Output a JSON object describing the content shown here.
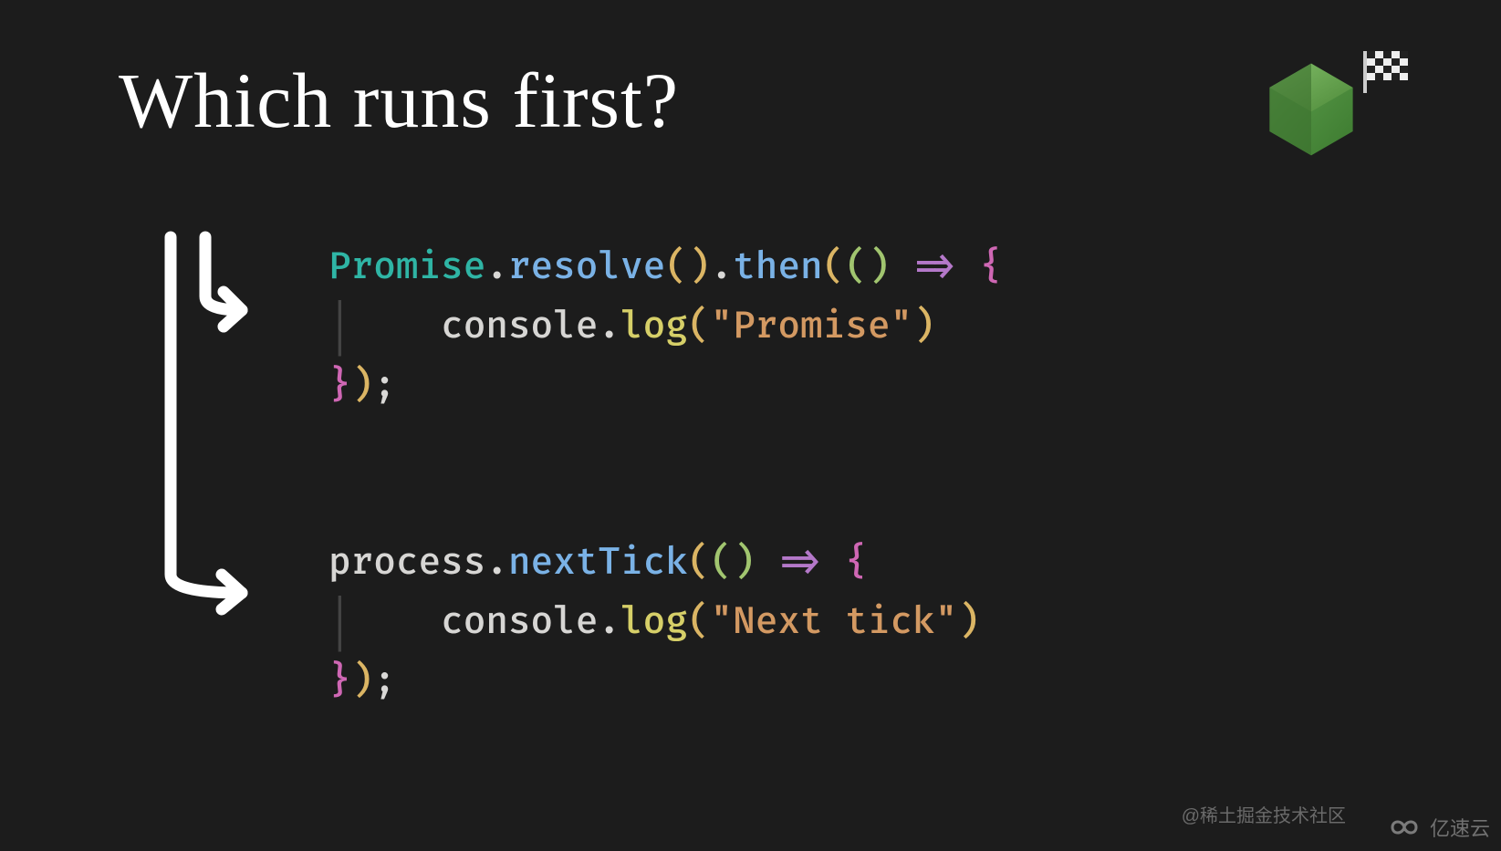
{
  "title": "Which runs first?",
  "code": {
    "block1": {
      "line1": {
        "promise": "Promise",
        "dot1": ".",
        "resolve": "resolve",
        "p1": "()",
        "dot2": ".",
        "then": "then",
        "po": "(",
        "pi": "()",
        "sp": " ",
        "arrow": "=>",
        "sp2": " ",
        "brace": "{"
      },
      "line2": {
        "indent": "    ",
        "console": "console",
        "dot": ".",
        "log": "log",
        "po": "(",
        "str": "\"Promise\"",
        "pc": ")"
      },
      "line3": {
        "brace": "}",
        "pc": ")",
        "semi": ";"
      }
    },
    "gap": "\n\n",
    "block2": {
      "line1": {
        "process": "process",
        "dot": ".",
        "nexttick": "nextTick",
        "po": "(",
        "pi": "()",
        "sp": " ",
        "arrow": "=>",
        "sp2": " ",
        "brace": "{"
      },
      "line2": {
        "indent": "    ",
        "console": "console",
        "dot": ".",
        "log": "log",
        "po": "(",
        "str": "\"Next tick\"",
        "pc": ")"
      },
      "line3": {
        "brace": "}",
        "pc": ")",
        "semi": ";"
      }
    }
  },
  "footer": {
    "credit": "@稀土掘金技术社区",
    "brand": "亿速云"
  },
  "icons": {
    "node": "node-logo",
    "flag": "checkered-flag"
  }
}
